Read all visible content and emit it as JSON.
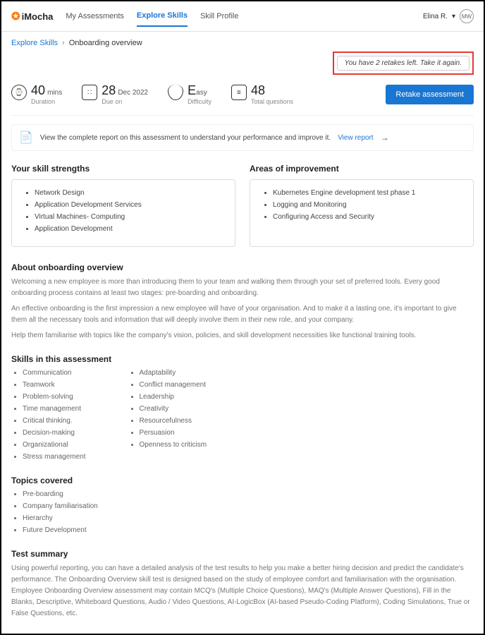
{
  "header": {
    "brand": "iMocha",
    "nav": {
      "my_assessments": "My Assessments",
      "explore_skills": "Explore Skills",
      "skill_profile": "Skill Profile"
    },
    "user_name": "Elina R.",
    "user_initials": "MW"
  },
  "breadcrumb": {
    "root": "Explore Skills",
    "current": "Onboarding overview"
  },
  "retake_notice": "You have 2 retakes left. Take it again.",
  "stats": {
    "duration_value": "40",
    "duration_unit": "mins",
    "duration_label": "Duration",
    "due_value": "28",
    "due_unit": "Dec 2022",
    "due_label": "Due on",
    "diff_value": "E",
    "diff_unit": "asy",
    "diff_label": "Difficulty",
    "total_value": "48",
    "total_label": "Total questions",
    "retake_btn": "Retake assessment"
  },
  "report_banner": {
    "text": "View the complete report on this assessment to understand your performance and improve it.",
    "link": "View report"
  },
  "strengths": {
    "title": "Your skill strengths",
    "items": [
      "Network Design",
      "Application Development Services",
      "Virtual Machines- Computing",
      "Application Development"
    ]
  },
  "improve": {
    "title": "Areas of improvement",
    "items": [
      "Kubernetes Engine development test phase 1",
      "Logging and Monitoring",
      "Configuring Access and Security"
    ]
  },
  "about": {
    "title": "About onboarding overview",
    "p1": "Welcoming a new employee is more than introducing them to your team and walking them through your set of preferred tools. Every good onboarding process contains at least two stages: pre-boarding and onboarding.",
    "p2": "An effective onboarding is the first impression a new employee will have of your organisation. And to make it a lasting one, it's important to give them all the necessary tools and information that will deeply involve them in their new role, and your company.",
    "p3": "Help them familiarise with topics like the company's vision, policies, and skill development necessities like functional training tools."
  },
  "skills": {
    "title": "Skills in this assessment",
    "col1": [
      "Communication",
      "Teamwork",
      "Problem-solving",
      "Time management",
      "Critical thinking.",
      "Decision-making",
      "Organizational",
      "Stress management"
    ],
    "col2": [
      "Adaptability",
      "Conflict management",
      "Leadership",
      "Creativity",
      "Resourcefulness",
      "Persuasion",
      "Openness to criticism"
    ]
  },
  "topics": {
    "title": "Topics covered",
    "items": [
      "Pre-boarding",
      "Company familiarisation",
      "Hierarchy",
      "Future Development"
    ]
  },
  "summary": {
    "title": "Test summary",
    "p": "Using powerful reporting, you can have a detailed analysis of the test results to help you make a better hiring decision and predict the candidate's performance. The Onboarding Overview skill test is designed based on the study of employee comfort and familiarisation with the organisation. Employee Onboarding Overview assessment may contain MCQ's (Multiple Choice Questions), MAQ's (Multiple Answer Questions), Fill in the Blanks, Descriptive, Whiteboard Questions, Audio / Video Questions, AI-LogicBox (AI-based Pseudo-Coding Platform), Coding Simulations, True or False Questions, etc."
  }
}
